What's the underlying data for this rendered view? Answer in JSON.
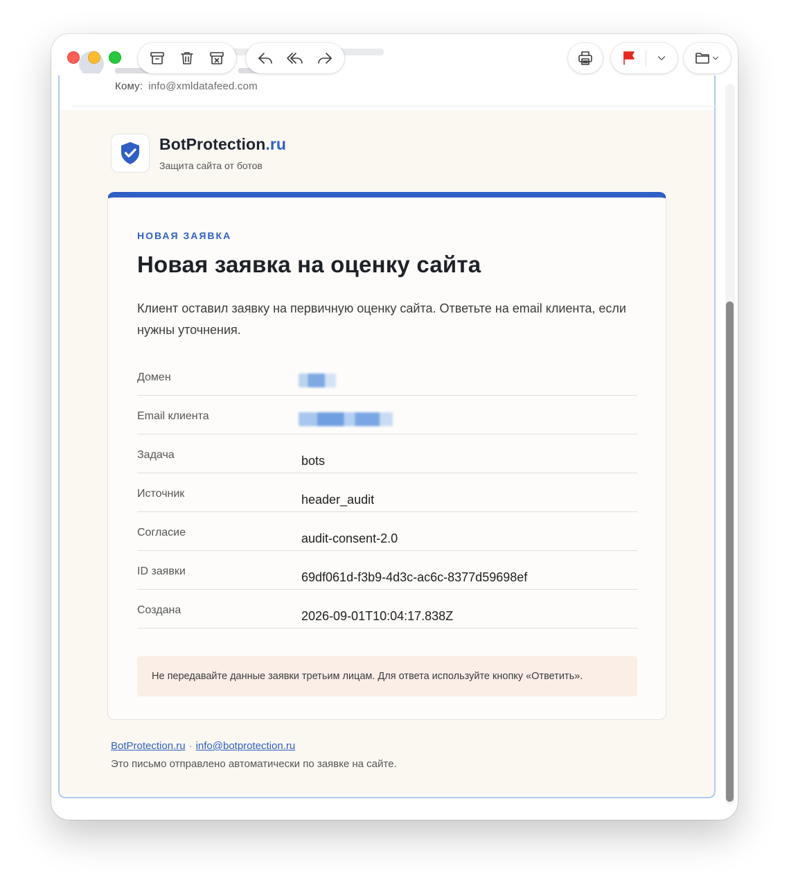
{
  "toolbar": {
    "left_group": [
      "archive-icon",
      "trash-icon",
      "junk-icon"
    ],
    "reply_group": [
      "reply-icon",
      "reply-all-icon",
      "forward-icon"
    ],
    "print": "print-icon",
    "flag_color": "#e5271f",
    "move": "folder-icon"
  },
  "email_header": {
    "to_label": "Кому:",
    "to_value": "info@xmldatafeed.com"
  },
  "brand": {
    "name": "BotProtection",
    "tld": ".ru",
    "tagline": "Защита сайта от ботов",
    "accent": "#2f5fc4"
  },
  "card": {
    "kicker": "НОВАЯ ЗАЯВКА",
    "title": "Новая заявка на оценку сайта",
    "intro": "Клиент оставил заявку на первичную оценку сайта. Ответьте на email клиента, если нужны уточнения.",
    "rows": [
      {
        "label": "Домен",
        "value": ""
      },
      {
        "label": "Email клиента",
        "value": ""
      },
      {
        "label": "Задача",
        "value": "bots"
      },
      {
        "label": "Источник",
        "value": "header_audit"
      },
      {
        "label": "Согласие",
        "value": "audit-consent-2.0"
      },
      {
        "label": "ID заявки",
        "value": "69df061d-f3b9-4d3c-ac6c-8377d59698ef"
      },
      {
        "label": "Создана",
        "value": "2026-09-01T10:04:17.838Z"
      }
    ],
    "notice": "Не передавайте данные заявки третьим лицам. Для ответа используйте кнопку «Ответить»."
  },
  "footer": {
    "site_link": "BotProtection.ru",
    "separator": "·",
    "email_link": "info@botprotection.ru",
    "note": "Это письмо отправлено автоматически по заявке на сайте."
  }
}
